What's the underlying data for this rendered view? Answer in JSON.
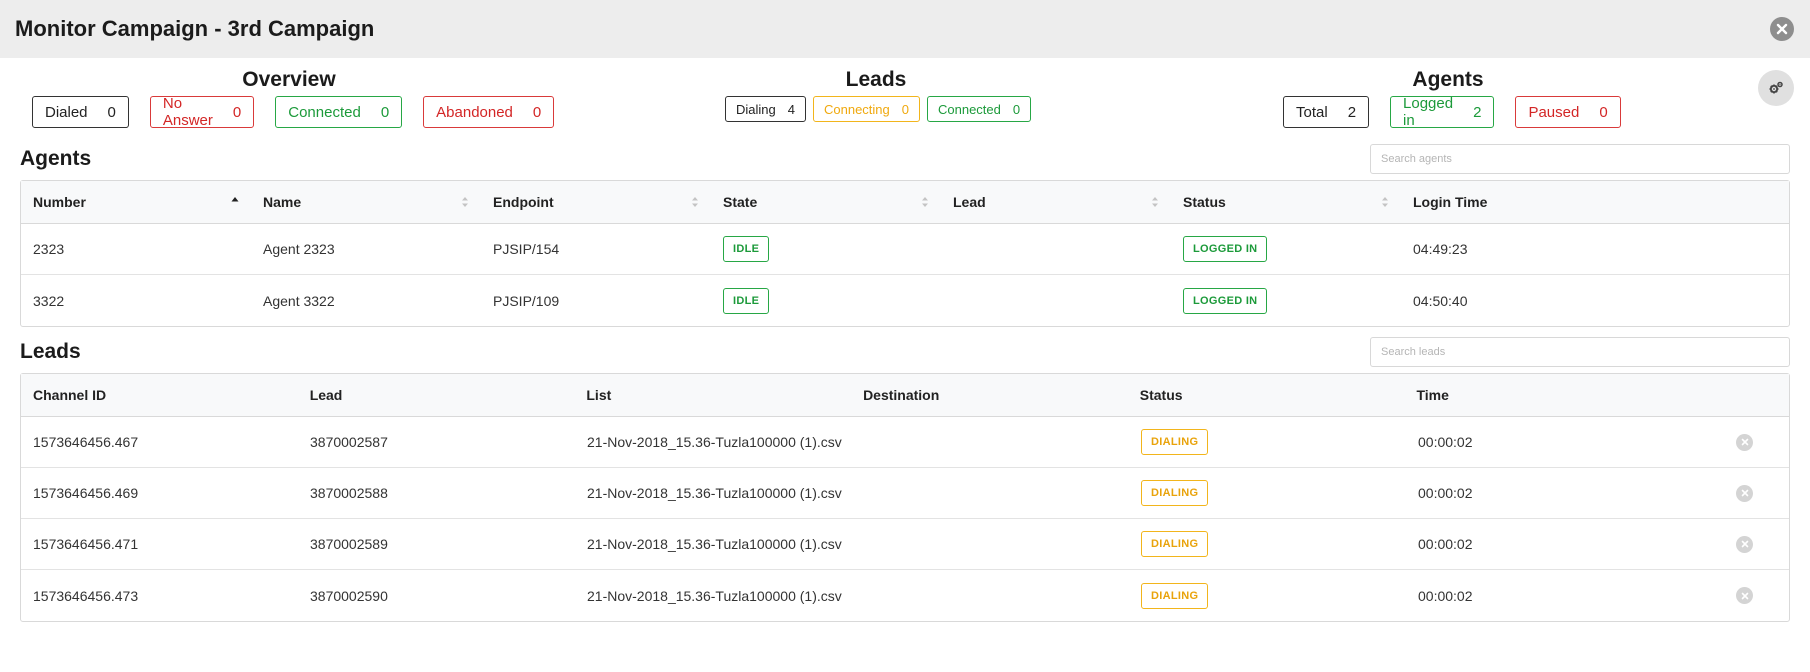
{
  "header": {
    "title": "Monitor Campaign - 3rd Campaign"
  },
  "overview": {
    "title": "Overview",
    "stats": [
      {
        "label": "Dialed",
        "value": "0"
      },
      {
        "label": "No Answer",
        "value": "0"
      },
      {
        "label": "Connected",
        "value": "0"
      },
      {
        "label": "Abandoned",
        "value": "0"
      }
    ]
  },
  "leads_summary": {
    "title": "Leads",
    "stats": [
      {
        "label": "Dialing",
        "value": "4"
      },
      {
        "label": "Connecting",
        "value": "0"
      },
      {
        "label": "Connected",
        "value": "0"
      }
    ]
  },
  "agents_summary": {
    "title": "Agents",
    "stats": [
      {
        "label": "Total",
        "value": "2"
      },
      {
        "label": "Logged in",
        "value": "2"
      },
      {
        "label": "Paused",
        "value": "0"
      }
    ]
  },
  "agents": {
    "title": "Agents",
    "search_placeholder": "Search agents",
    "columns": [
      "Number",
      "Name",
      "Endpoint",
      "State",
      "Lead",
      "Status",
      "Login Time"
    ],
    "rows": [
      {
        "number": "2323",
        "name": "Agent 2323",
        "endpoint": "PJSIP/154",
        "state": "IDLE",
        "lead": "",
        "status": "LOGGED IN",
        "login_time": "04:49:23"
      },
      {
        "number": "3322",
        "name": "Agent 3322",
        "endpoint": "PJSIP/109",
        "state": "IDLE",
        "lead": "",
        "status": "LOGGED IN",
        "login_time": "04:50:40"
      }
    ]
  },
  "leads": {
    "title": "Leads",
    "search_placeholder": "Search leads",
    "columns": [
      "Channel ID",
      "Lead",
      "List",
      "Destination",
      "Status",
      "Time"
    ],
    "rows": [
      {
        "channel_id": "1573646456.467",
        "lead": "3870002587",
        "list": "21-Nov-2018_15.36-Tuzla100000 (1).csv",
        "destination": "",
        "status": "DIALING",
        "time": "00:00:02"
      },
      {
        "channel_id": "1573646456.469",
        "lead": "3870002588",
        "list": "21-Nov-2018_15.36-Tuzla100000 (1).csv",
        "destination": "",
        "status": "DIALING",
        "time": "00:00:02"
      },
      {
        "channel_id": "1573646456.471",
        "lead": "3870002589",
        "list": "21-Nov-2018_15.36-Tuzla100000 (1).csv",
        "destination": "",
        "status": "DIALING",
        "time": "00:00:02"
      },
      {
        "channel_id": "1573646456.473",
        "lead": "3870002590",
        "list": "21-Nov-2018_15.36-Tuzla100000 (1).csv",
        "destination": "",
        "status": "DIALING",
        "time": "00:00:02"
      }
    ]
  },
  "colors": {
    "green": "#27a745",
    "red": "#d93a3a",
    "yellow": "#f2b51c",
    "header_bg": "#ededed"
  },
  "icons": {
    "close": "close-circle-icon",
    "settings": "gears-icon",
    "sort": "sort-arrows-icon",
    "row_remove": "remove-circle-icon"
  }
}
